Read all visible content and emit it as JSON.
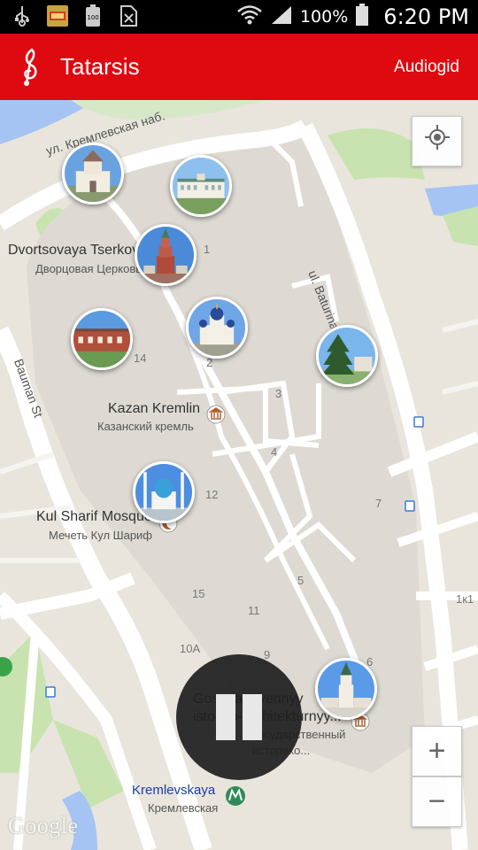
{
  "status_bar": {
    "icons": [
      "usb-icon",
      "notification-app-icon",
      "battery-100-icon",
      "no-sim-icon"
    ],
    "battery_percent": "100%",
    "time": "6:20 PM"
  },
  "app_bar": {
    "title": "Tatarsis",
    "action_label": "Audiogid",
    "brand_color": "#df0a10"
  },
  "map": {
    "streets": {
      "top": "ул. Кремлевская наб.",
      "right": "ul. Baturina",
      "left": "Bauman St"
    },
    "places": [
      {
        "en": "Dvortsovaya Tserkov",
        "ru": "Дворцовая Церковь"
      },
      {
        "en": "Kazan Kremlin",
        "ru": "Казанский кремль"
      },
      {
        "en": "Kul Sharif Mosque",
        "ru": "Мечеть Кул Шариф"
      },
      {
        "en": "Gosudarstvennyy istoriko-arkhitekturnyy...",
        "ru": "Государственный историко..."
      },
      {
        "en": "Kremlevskaya",
        "ru": "Кремлевская"
      }
    ],
    "numbers": [
      "1",
      "2",
      "3",
      "4",
      "5",
      "6",
      "7",
      "9",
      "10A",
      "11",
      "12",
      "14",
      "15",
      "1к1"
    ],
    "markers": [
      "tower-gate-marker",
      "governor-palace-marker",
      "syuyumbike-tower-marker",
      "cannon-yard-marker",
      "annunciation-cathedral-marker",
      "fir-tree-marker",
      "kul-sharif-mosque-marker",
      "spasskaya-tower-marker"
    ],
    "attribution": "Google"
  },
  "controls": {
    "zoom_in": "+",
    "zoom_out": "−",
    "my_location_icon": "crosshair-icon",
    "player_state": "pause-icon"
  }
}
